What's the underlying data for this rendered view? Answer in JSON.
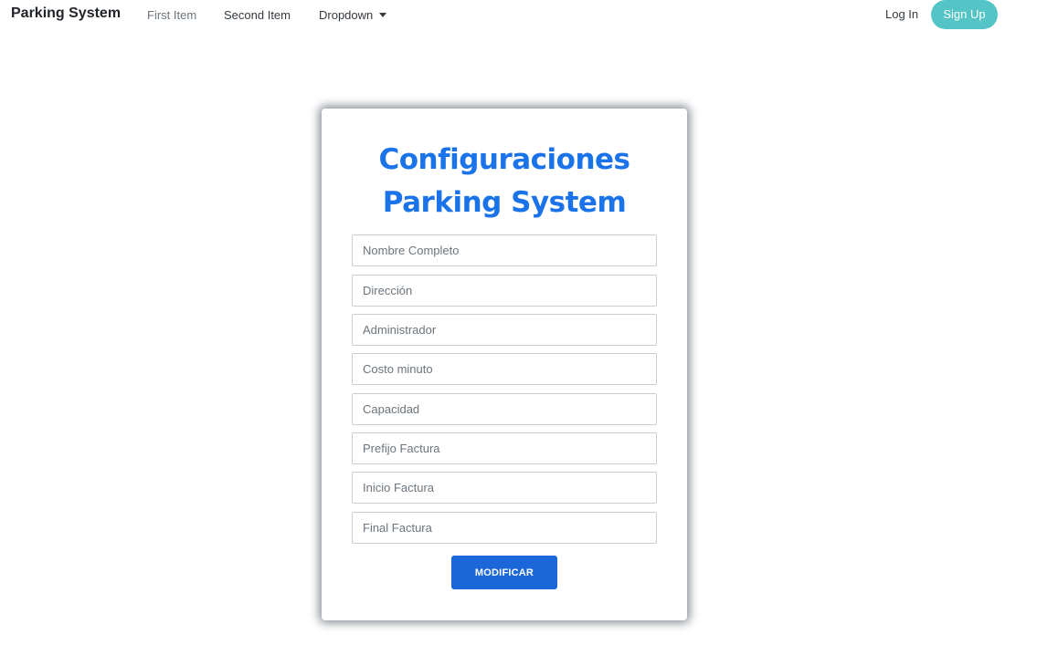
{
  "navbar": {
    "brand": "Parking System",
    "links": [
      "First Item",
      "Second Item",
      "Dropdown"
    ],
    "login": "Log In",
    "signup": "Sign Up"
  },
  "form": {
    "title_line1": "Configuraciones",
    "title_line2": "Parking System",
    "fields": [
      {
        "placeholder": "Nombre Completo",
        "value": ""
      },
      {
        "placeholder": "Dirección",
        "value": ""
      },
      {
        "placeholder": "Administrador",
        "value": ""
      },
      {
        "placeholder": "Costo minuto",
        "value": ""
      },
      {
        "placeholder": "Capacidad",
        "value": ""
      },
      {
        "placeholder": "Prefijo Factura",
        "value": ""
      },
      {
        "placeholder": "Inicio Factura",
        "value": ""
      },
      {
        "placeholder": "Final Factura",
        "value": ""
      }
    ],
    "submit_label": "MODIFICAR"
  },
  "colors": {
    "title": "#1a73e8",
    "button": "#1b67d9",
    "signup": "#55c4c6"
  }
}
